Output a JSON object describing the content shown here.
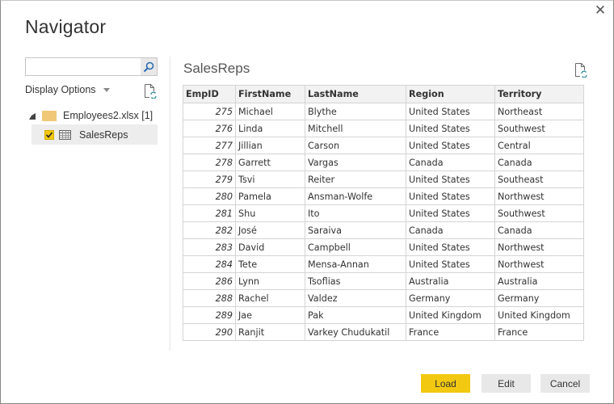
{
  "window": {
    "title": "Navigator",
    "close_icon": "close-icon"
  },
  "left_pane": {
    "search": {
      "value": "",
      "placeholder": "",
      "icon": "search-icon"
    },
    "display_options_label": "Display Options",
    "refresh_icon": "refresh-document-icon",
    "tree": {
      "parent": {
        "label": "Employees2.xlsx [1]",
        "icon": "folder-icon",
        "expanded": true
      },
      "children": [
        {
          "label": "SalesReps",
          "icon": "table-icon",
          "checked": true,
          "selected": true
        }
      ]
    }
  },
  "preview": {
    "title": "SalesReps",
    "refresh_icon": "refresh-document-icon",
    "columns": [
      "EmpID",
      "FirstName",
      "LastName",
      "Region",
      "Territory"
    ],
    "rows": [
      [
        "275",
        "Michael",
        "Blythe",
        "United States",
        "Northeast"
      ],
      [
        "276",
        "Linda",
        "Mitchell",
        "United States",
        "Southwest"
      ],
      [
        "277",
        "Jillian",
        "Carson",
        "United States",
        "Central"
      ],
      [
        "278",
        "Garrett",
        "Vargas",
        "Canada",
        "Canada"
      ],
      [
        "279",
        "Tsvi",
        "Reiter",
        "United States",
        "Southeast"
      ],
      [
        "280",
        "Pamela",
        "Ansman-Wolfe",
        "United States",
        "Northwest"
      ],
      [
        "281",
        "Shu",
        "Ito",
        "United States",
        "Southwest"
      ],
      [
        "282",
        "José",
        "Saraiva",
        "Canada",
        "Canada"
      ],
      [
        "283",
        "David",
        "Campbell",
        "United States",
        "Northwest"
      ],
      [
        "284",
        "Tete",
        "Mensa-Annan",
        "United States",
        "Northwest"
      ],
      [
        "286",
        "Lynn",
        "Tsoflias",
        "Australia",
        "Australia"
      ],
      [
        "288",
        "Rachel",
        "Valdez",
        "Germany",
        "Germany"
      ],
      [
        "289",
        "Jae",
        "Pak",
        "United Kingdom",
        "United Kingdom"
      ],
      [
        "290",
        "Ranjit",
        "Varkey Chudukatil",
        "France",
        "France"
      ]
    ]
  },
  "footer": {
    "load_label": "Load",
    "edit_label": "Edit",
    "cancel_label": "Cancel"
  },
  "colors": {
    "accent": "#f2c811",
    "secondary_button": "#e8e8e8",
    "selected_row": "#ededed",
    "folder": "#f0c878",
    "refresh_arrows": "#2e8b9a"
  }
}
